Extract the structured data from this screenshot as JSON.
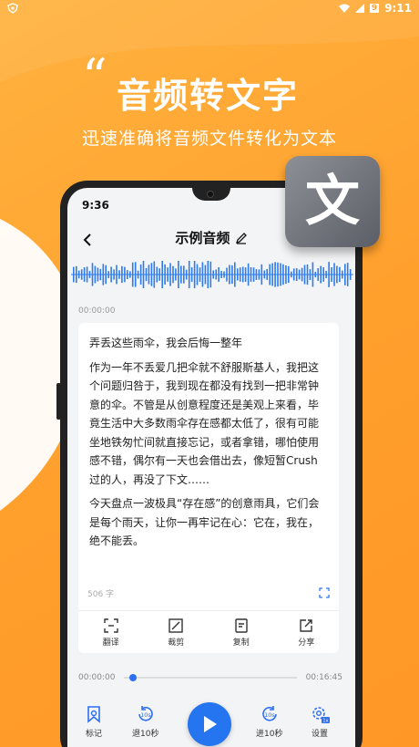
{
  "status": {
    "battery": "9",
    "time": "9:11"
  },
  "header": {
    "title": "音频转文字",
    "subtitle": "迅速准确将音频文件转化为文本"
  },
  "badge": {
    "char": "文"
  },
  "phone": {
    "status_time": "9:36",
    "nav": {
      "title": "示例音频"
    },
    "timestamp_start": "00:00:00",
    "content": {
      "paragraphs": [
        "弄丢这些雨伞，我会后悔一整年",
        "作为一年不丢爱几把伞就不舒服斯基人，我把这个问题归咎于，我到现在都没有找到一把非常钟意的伞。不管是从创意程度还是美观上来看，毕竟生活中大多数雨伞存在感都太低了，很有可能坐地铁匆忙间就直接忘记，或者拿错，哪怕使用感不错，偶尔有一天也会借出去，像短暂Crush过的人，再没了下文……",
        "今天盘点一波极具“存在感”的创意雨具，它们会是每个雨天，让你一再牢记在心：它在，我在，绝不能丢。"
      ],
      "word_count": "506 字"
    },
    "tools": [
      {
        "label": "翻译",
        "icon": "translate-icon"
      },
      {
        "label": "裁剪",
        "icon": "crop-icon"
      },
      {
        "label": "复制",
        "icon": "copy-icon"
      },
      {
        "label": "分享",
        "icon": "share-icon"
      }
    ],
    "player": {
      "current": "00:00:00",
      "total": "00:16:45",
      "progress": 0.03
    },
    "controls": [
      {
        "label": "标记",
        "icon": "bookmark-icon"
      },
      {
        "label": "退10秒",
        "icon": "rewind-10-icon",
        "badge": "10s"
      },
      {
        "label": "进10秒",
        "icon": "forward-10-icon",
        "badge": "10s"
      },
      {
        "label": "设置",
        "icon": "settings-icon",
        "badge": "1x"
      }
    ]
  },
  "colors": {
    "accent": "#2574f0",
    "background": "#ff9f2c",
    "wave": "#2f7bea"
  }
}
